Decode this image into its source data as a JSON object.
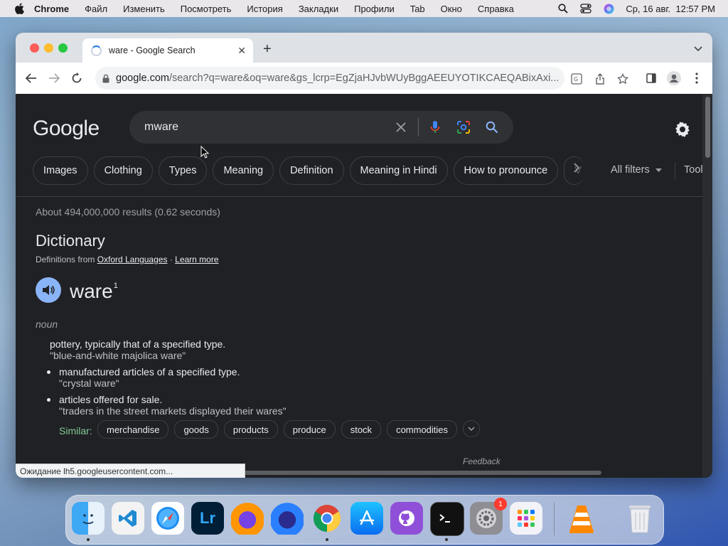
{
  "menubar": {
    "app_name": "Chrome",
    "items": [
      "Файл",
      "Изменить",
      "Посмотреть",
      "История",
      "Закладки",
      "Профили",
      "Tab",
      "Окно",
      "Справка"
    ],
    "datetime": "Ср, 16 авг.  12:57 PM"
  },
  "browser": {
    "tab_title": "ware - Google Search",
    "url_host": "google.com",
    "url_rest": "/search?q=ware&oq=ware&gs_lcrp=EgZjaHJvbWUyBggAEEUYOTIKCAEQABixAxi..."
  },
  "page": {
    "logo": "Google",
    "search_query": "mware",
    "chips": [
      "Images",
      "Clothing",
      "Types",
      "Meaning",
      "Definition",
      "Meaning in Hindi",
      "How to pronounce"
    ],
    "chip_partial": "V",
    "all_filters": "All filters",
    "tools": "Tools",
    "result_stats": "About 494,000,000 results (0.62 seconds)",
    "dictionary": {
      "heading": "Dictionary",
      "source_prefix": "Definitions from",
      "source_link": "Oxford Languages",
      "separator": "·",
      "learn_more": "Learn more",
      "word": "ware",
      "word_index": "1",
      "part_of_speech": "noun",
      "definitions": [
        {
          "text": "pottery, typically that of a specified type.",
          "example": "\"blue-and-white majolica ware\""
        },
        {
          "text": "manufactured articles of a specified type.",
          "example": "\"crystal ware\""
        },
        {
          "text": "articles offered for sale.",
          "example": "\"traders in the street markets displayed their wares\""
        }
      ],
      "similar_label": "Similar:",
      "similar": [
        "merchandise",
        "goods",
        "products",
        "produce",
        "stock",
        "commodities"
      ],
      "feedback": "Feedback"
    },
    "status_bar": "Ожидание lh5.googleusercontent.com..."
  },
  "dock": {
    "apps": [
      "finder",
      "vscode",
      "safari",
      "lightroom",
      "firefox",
      "firefox-dev",
      "chrome",
      "app-store",
      "github-desktop",
      "terminal",
      "system-settings",
      "launchpad",
      "vlc",
      "trash"
    ],
    "lightroom_label": "Lr",
    "settings_badge": "1"
  },
  "colors": {
    "page_bg": "#202124",
    "accent_blue": "#8ab4f8",
    "similar_green": "#81c995"
  }
}
